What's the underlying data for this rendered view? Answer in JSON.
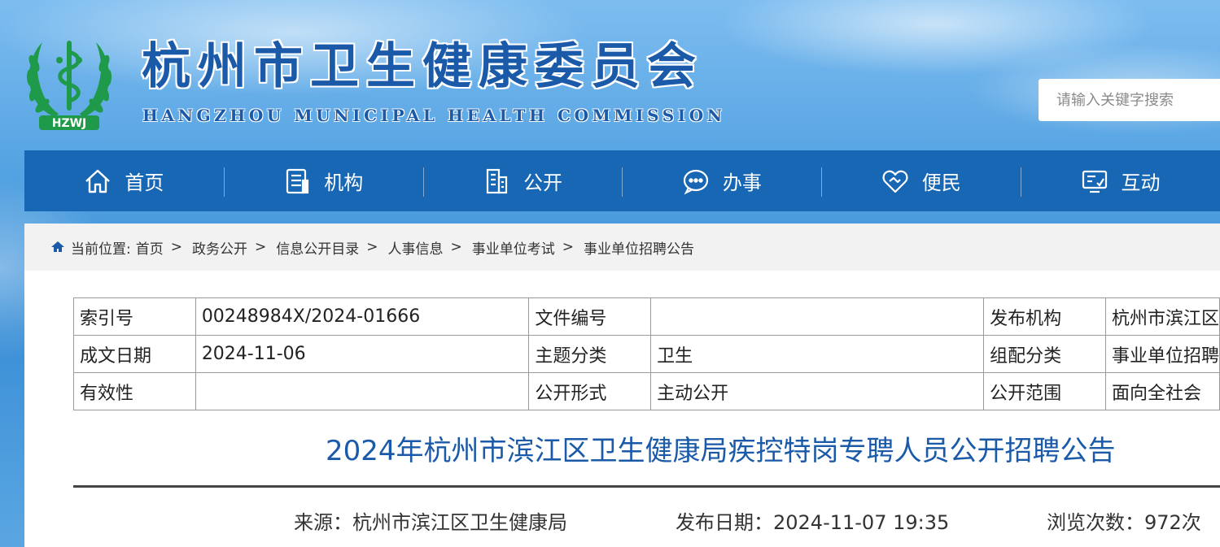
{
  "header": {
    "logo_text": "HZWJ",
    "title": "杭州市卫生健康委员会",
    "subtitle": "HANGZHOU MUNICIPAL HEALTH COMMISSION",
    "search_placeholder": "请输入关键字搜索"
  },
  "nav": [
    {
      "label": "首页",
      "icon": "home-icon"
    },
    {
      "label": "机构",
      "icon": "building-document-icon"
    },
    {
      "label": "公开",
      "icon": "office-building-icon"
    },
    {
      "label": "办事",
      "icon": "chat-bubble-icon"
    },
    {
      "label": "便民",
      "icon": "heart-handshake-icon"
    },
    {
      "label": "互动",
      "icon": "interaction-screen-icon"
    }
  ],
  "breadcrumb": {
    "prefix": "当前位置:",
    "items": [
      "首页",
      "政务公开",
      "信息公开目录",
      "人事信息",
      "事业单位考试",
      "事业单位招聘公告"
    ],
    "separator": ">"
  },
  "meta_table": [
    [
      "索引号",
      "00248984X/2024-01666",
      "文件编号",
      "",
      "发布机构",
      "杭州市滨江区"
    ],
    [
      "成文日期",
      "2024-11-06",
      "主题分类",
      "卫生",
      "组配分类",
      "事业单位招聘"
    ],
    [
      "有效性",
      "",
      "公开形式",
      "主动公开",
      "公开范围",
      "面向全社会"
    ]
  ],
  "article": {
    "title": "2024年杭州市滨江区卫生健康局疾控特岗专聘人员公开招聘公告",
    "source": "来源：杭州市滨江区卫生健康局",
    "publish_date": "发布日期：2024-11-07 19:35",
    "views": "浏览次数：972次"
  },
  "colors": {
    "nav_bg": "#1767b4",
    "title_blue": "#1b5aa8",
    "logo_green": "#1f9a4a"
  }
}
